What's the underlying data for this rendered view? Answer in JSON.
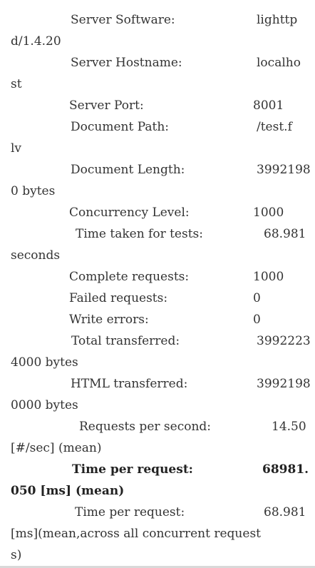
{
  "lines": [
    {
      "label": "Server Software:",
      "value": "lighttp",
      "cont": "d/1.4.20"
    },
    {
      "label": "Server Hostname:",
      "value": "localho",
      "cont": "st"
    },
    {
      "label": "Server Port:",
      "value": "8001"
    },
    {
      "label": "Document Path:",
      "value": "/test.f",
      "cont": "lv"
    },
    {
      "label": "Document Length:",
      "value": "3992198",
      "cont": "0 bytes"
    },
    {
      "label": "Concurrency Level:",
      "value": "1000"
    },
    {
      "label": "Time taken for tests:",
      "value": "68.981",
      "cont": "seconds"
    },
    {
      "label": "Complete requests:",
      "value": "1000"
    },
    {
      "label": "Failed requests:",
      "value": "0"
    },
    {
      "label": "Write errors:",
      "value": "0"
    },
    {
      "label": "Total transferred:",
      "value": "3992223",
      "cont": "4000 bytes"
    },
    {
      "label": "HTML transferred:",
      "value": "3992198",
      "cont": "0000 bytes"
    },
    {
      "label": "Requests per second:",
      "value": "14.50",
      "cont": "[#/sec] (mean)"
    },
    {
      "label": "Time per request:",
      "value": "68981.",
      "cont": "050 [ms] (mean)",
      "bold": true
    },
    {
      "label": "Time per request:",
      "value": "68.981",
      "cont": "[ms](mean,across all concurrent request",
      "cont2": "s)"
    }
  ]
}
